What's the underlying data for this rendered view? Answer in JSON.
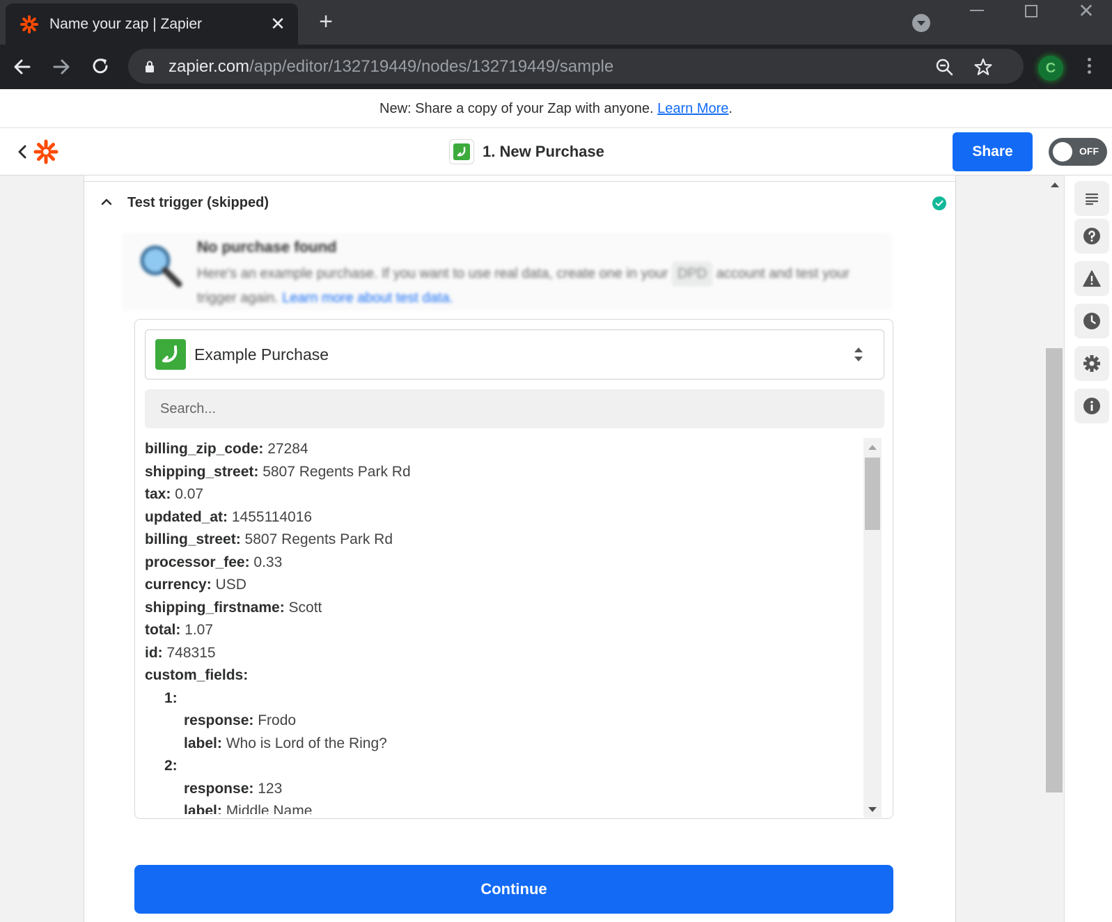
{
  "browser": {
    "tab_title": "Name your zap | Zapier",
    "url_host": "zapier.com",
    "url_path": "/app/editor/132719449/nodes/132719449/sample",
    "profile_initial": "C"
  },
  "announcement": {
    "text": "New: Share a copy of your Zap with anyone. ",
    "link": "Learn More",
    "suffix": "."
  },
  "header": {
    "step_title": "1. New Purchase",
    "share_label": "Share",
    "toggle_label": "OFF"
  },
  "section": {
    "title": "Test trigger (skipped)"
  },
  "notice": {
    "title": "No purchase found",
    "text_before": "Here's an example purchase. If you want to use real data, create one in your ",
    "app_chip": "DPD",
    "text_after": " account and test your trigger again. ",
    "link": "Learn more about test data."
  },
  "record": {
    "label": "Example Purchase",
    "search_placeholder": "Search..."
  },
  "fields": [
    {
      "key": "billing_zip_code:",
      "value": " 27284",
      "level": 0
    },
    {
      "key": "shipping_street:",
      "value": " 5807 Regents Park Rd",
      "level": 0
    },
    {
      "key": "tax:",
      "value": " 0.07",
      "level": 0
    },
    {
      "key": "updated_at:",
      "value": " 1455114016",
      "level": 0
    },
    {
      "key": "billing_street:",
      "value": " 5807 Regents Park Rd",
      "level": 0
    },
    {
      "key": "processor_fee:",
      "value": " 0.33",
      "level": 0
    },
    {
      "key": "currency:",
      "value": " USD",
      "level": 0
    },
    {
      "key": "shipping_firstname:",
      "value": " Scott",
      "level": 0
    },
    {
      "key": "total:",
      "value": " 1.07",
      "level": 0
    },
    {
      "key": "id:",
      "value": " 748315",
      "level": 0
    },
    {
      "key": "custom_fields:",
      "value": "",
      "level": 0
    },
    {
      "key": "1:",
      "value": "",
      "level": 1
    },
    {
      "key": "response:",
      "value": " Frodo",
      "level": 2
    },
    {
      "key": "label:",
      "value": " Who is Lord of the Ring?",
      "level": 2
    },
    {
      "key": "2:",
      "value": "",
      "level": 1
    },
    {
      "key": "response:",
      "value": " 123",
      "level": 2
    },
    {
      "key": "label:",
      "value": " Middle Name",
      "level": 2
    }
  ],
  "continue_label": "Continue",
  "rail_icons": [
    "notes-icon",
    "help-icon",
    "warning-icon",
    "history-icon",
    "settings-icon",
    "info-icon"
  ],
  "colors": {
    "brand_orange": "#ff4a00",
    "primary_blue": "#136bf5",
    "success_teal": "#13b89a",
    "dpd_green": "#3cab3c"
  }
}
